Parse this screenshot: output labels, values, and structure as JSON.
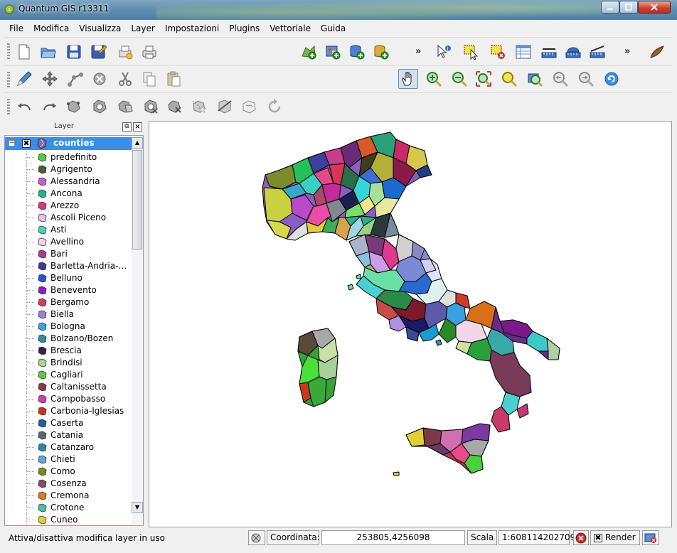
{
  "window": {
    "title": "Quantum GIS r13311"
  },
  "menu": [
    "File",
    "Modifica",
    "Visualizza",
    "Layer",
    "Impostazioni",
    "Plugins",
    "Vettoriale",
    "Guida"
  ],
  "toolbar": {
    "overflow_label": "»"
  },
  "layer_panel": {
    "title": "Layer",
    "float_icon": "float-icon",
    "close_icon": "close-icon",
    "root_layer": {
      "label": "counties",
      "checked": "✖",
      "expand": "−"
    },
    "items": [
      {
        "label": "predefinito",
        "color": "#4fce3a"
      },
      {
        "label": "Agrigento",
        "color": "#4d5a33"
      },
      {
        "label": "Alessandria",
        "color": "#c95bd6"
      },
      {
        "label": "Ancona",
        "color": "#27b08f"
      },
      {
        "label": "Arezzo",
        "color": "#e0357f"
      },
      {
        "label": "Ascoli Piceno",
        "color": "#e9c3ec"
      },
      {
        "label": "Asti",
        "color": "#3bd8c3"
      },
      {
        "label": "Avellino",
        "color": "#f6d0e4"
      },
      {
        "label": "Bari",
        "color": "#a83b8f"
      },
      {
        "label": "Barletta-Andria-…",
        "color": "#3a3a9b"
      },
      {
        "label": "Belluno",
        "color": "#2c4fd3"
      },
      {
        "label": "Benevento",
        "color": "#8a1ec7"
      },
      {
        "label": "Bergamo",
        "color": "#d8385a"
      },
      {
        "label": "Biella",
        "color": "#9a84d6"
      },
      {
        "label": "Bologna",
        "color": "#35a7ea"
      },
      {
        "label": "Bolzano/Bozen",
        "color": "#2a8f9e"
      },
      {
        "label": "Brescia",
        "color": "#3a1f4e"
      },
      {
        "label": "Brindisi",
        "color": "#a8d98f"
      },
      {
        "label": "Cagliari",
        "color": "#5ccc3f"
      },
      {
        "label": "Caltanissetta",
        "color": "#8a3a4a"
      },
      {
        "label": "Campobasso",
        "color": "#d63ba8"
      },
      {
        "label": "Carbonia-Iglesias",
        "color": "#c7321f"
      },
      {
        "label": "Caserta",
        "color": "#1f5fa8"
      },
      {
        "label": "Catania",
        "color": "#5a6a6a"
      },
      {
        "label": "Catanzaro",
        "color": "#2f87a8"
      },
      {
        "label": "Chieti",
        "color": "#5da8d8"
      },
      {
        "label": "Como",
        "color": "#7e8a1e"
      },
      {
        "label": "Cosenza",
        "color": "#8a4a6a"
      },
      {
        "label": "Cremona",
        "color": "#e07a1f"
      },
      {
        "label": "Crotone",
        "color": "#4ac0a8"
      },
      {
        "label": "Cuneo",
        "color": "#e0d030"
      }
    ]
  },
  "statusbar": {
    "message": "Attiva/disattiva modifica layer in uso",
    "coord_label": "Coordinata:",
    "coord_value": "253805,4256098",
    "scale_label": "Scala",
    "scale_value": "1:608114202709",
    "render_label": "Render",
    "render_checked": "✖"
  }
}
